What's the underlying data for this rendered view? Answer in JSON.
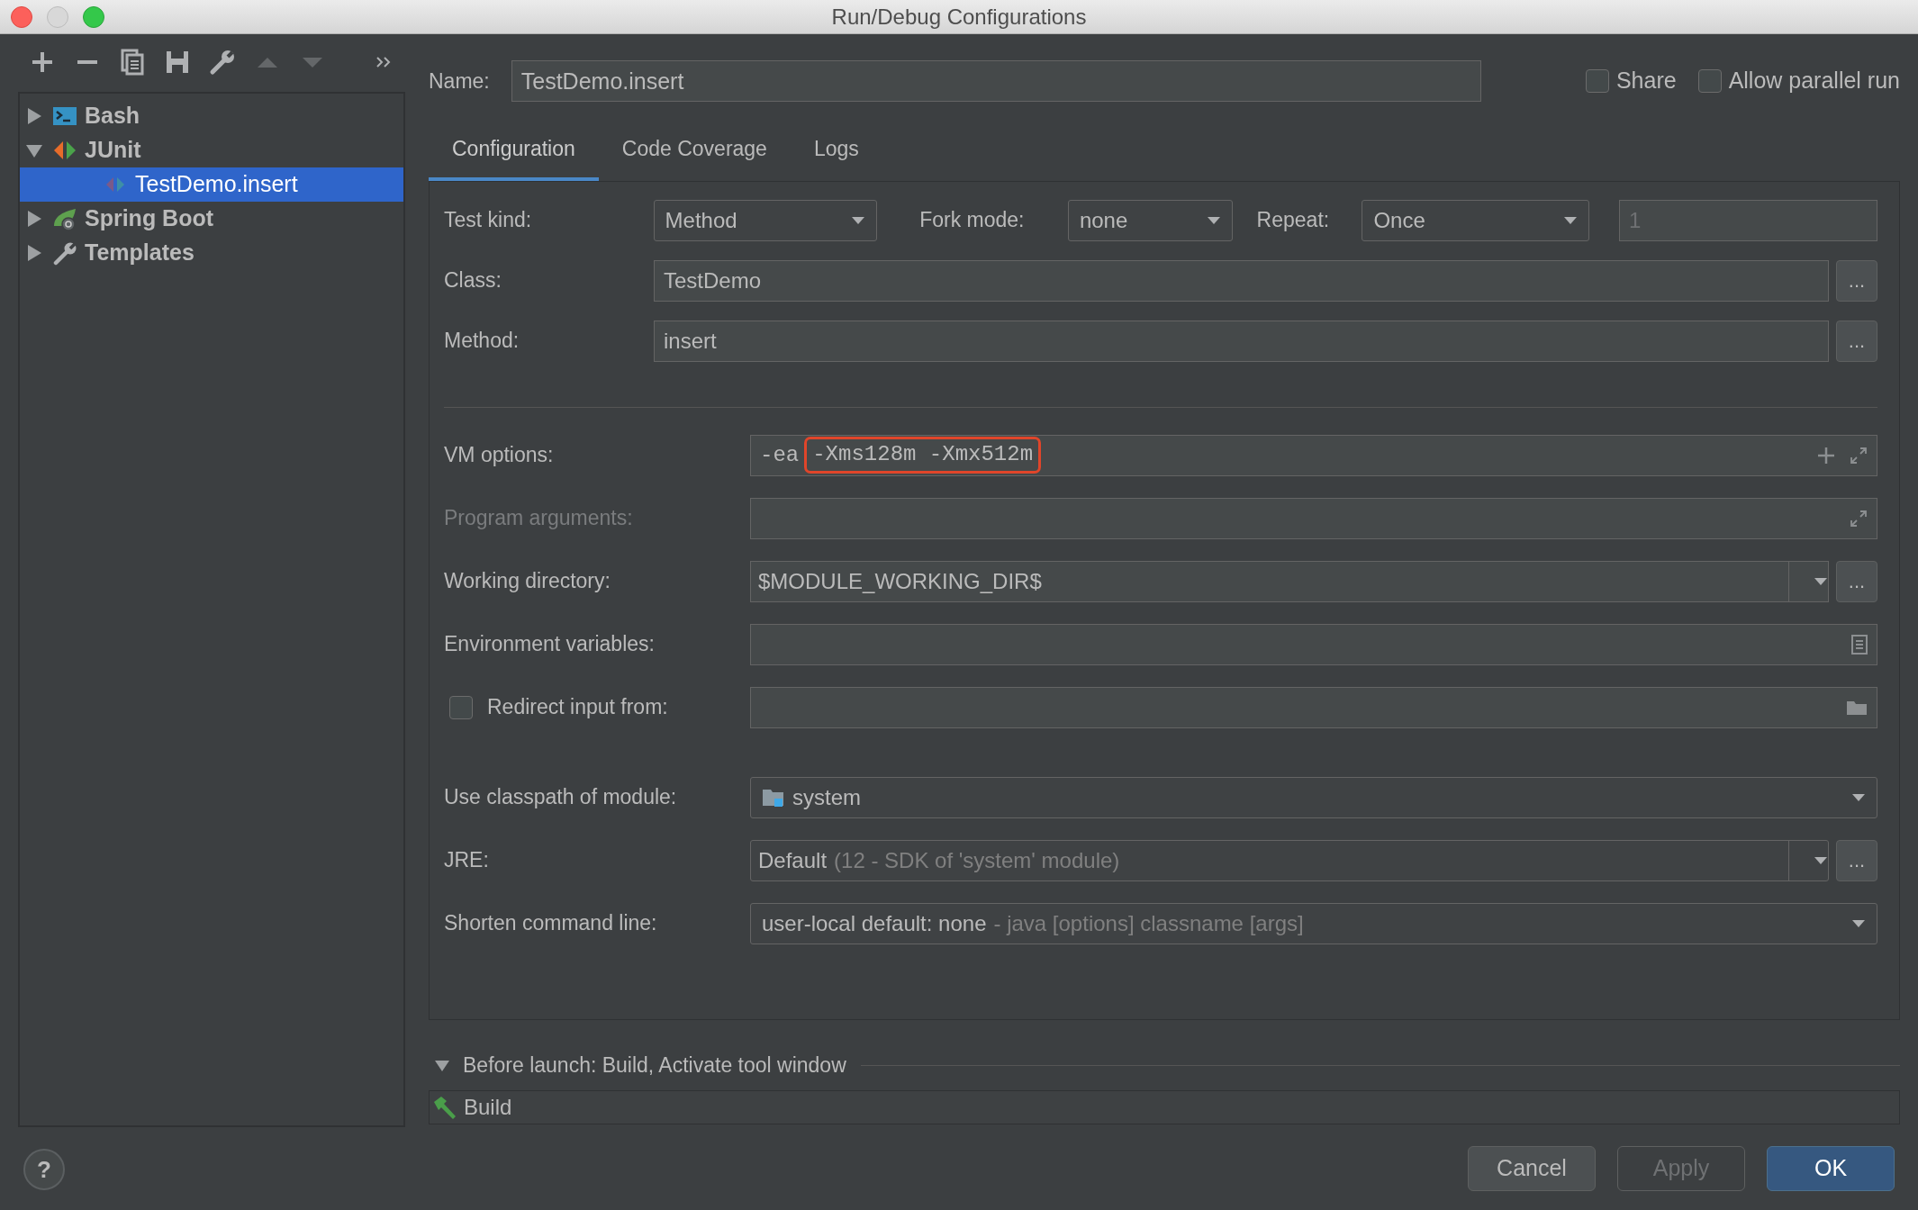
{
  "window": {
    "title": "Run/Debug Configurations"
  },
  "toolbar": [
    {
      "kind": "add",
      "disabled": false
    },
    {
      "kind": "remove",
      "disabled": false
    },
    {
      "kind": "copy",
      "disabled": false
    },
    {
      "kind": "save",
      "disabled": false
    },
    {
      "kind": "wrench",
      "disabled": false
    },
    {
      "kind": "up",
      "disabled": true
    },
    {
      "kind": "down",
      "disabled": true
    },
    {
      "kind": "more",
      "disabled": false
    }
  ],
  "tree": [
    {
      "label": "Bash",
      "kind": "bash",
      "expanded": false,
      "selected": false
    },
    {
      "label": "JUnit",
      "kind": "junit",
      "expanded": true,
      "selected": false,
      "children": [
        {
          "label": "TestDemo.insert",
          "kind": "junit-test",
          "selected": true
        }
      ]
    },
    {
      "label": "Spring Boot",
      "kind": "spring-boot",
      "expanded": false,
      "selected": false
    },
    {
      "label": "Templates",
      "kind": "templates",
      "expanded": false,
      "selected": false
    }
  ],
  "name_field": {
    "label": "Name:",
    "value": "TestDemo.insert"
  },
  "options": [
    {
      "label": "Share",
      "checked": false
    },
    {
      "label": "Allow parallel run",
      "checked": false
    }
  ],
  "tabs": [
    {
      "label": "Configuration",
      "selected": true
    },
    {
      "label": "Code Coverage",
      "selected": false
    },
    {
      "label": "Logs",
      "selected": false
    }
  ],
  "test_kind": {
    "label": "Test kind:",
    "value": "Method"
  },
  "fork_mode": {
    "label": "Fork mode:",
    "value": "none"
  },
  "repeat": {
    "label": "Repeat:",
    "value": "Once",
    "count": "1",
    "count_disabled": true
  },
  "class_field": {
    "label": "Class:",
    "value": "TestDemo",
    "button": "..."
  },
  "method_field": {
    "label": "Method:",
    "value": "insert",
    "button": "..."
  },
  "vm_options": {
    "label": "VM options:",
    "prefix": "-ea",
    "highlighted": "-Xms128m -Xmx512m"
  },
  "program_arguments": {
    "label": "Program arguments:",
    "disabled": true
  },
  "working_directory": {
    "label": "Working directory:",
    "value": "$MODULE_WORKING_DIR$",
    "button": "..."
  },
  "environment_variables": {
    "label": "Environment variables:"
  },
  "redirect_input": {
    "label": "Redirect input from:",
    "checked": false
  },
  "classpath_module": {
    "label": "Use classpath of module:",
    "value": "system"
  },
  "jre": {
    "label": "JRE:",
    "value": "Default",
    "detail": "(12 - SDK of 'system' module)",
    "button": "..."
  },
  "shorten_command_line": {
    "label": "Shorten command line:",
    "value": "user-local default: none",
    "detail": "- java [options] classname [args]"
  },
  "before_launch": {
    "title": "Before launch: Build, Activate tool window",
    "expanded": true,
    "tasks": [
      {
        "label": "Build"
      }
    ]
  },
  "help": "?",
  "buttons": [
    {
      "label": "Cancel",
      "kind": "default",
      "disabled": false
    },
    {
      "label": "Apply",
      "kind": "default",
      "disabled": true
    },
    {
      "label": "OK",
      "kind": "primary",
      "disabled": false
    }
  ]
}
